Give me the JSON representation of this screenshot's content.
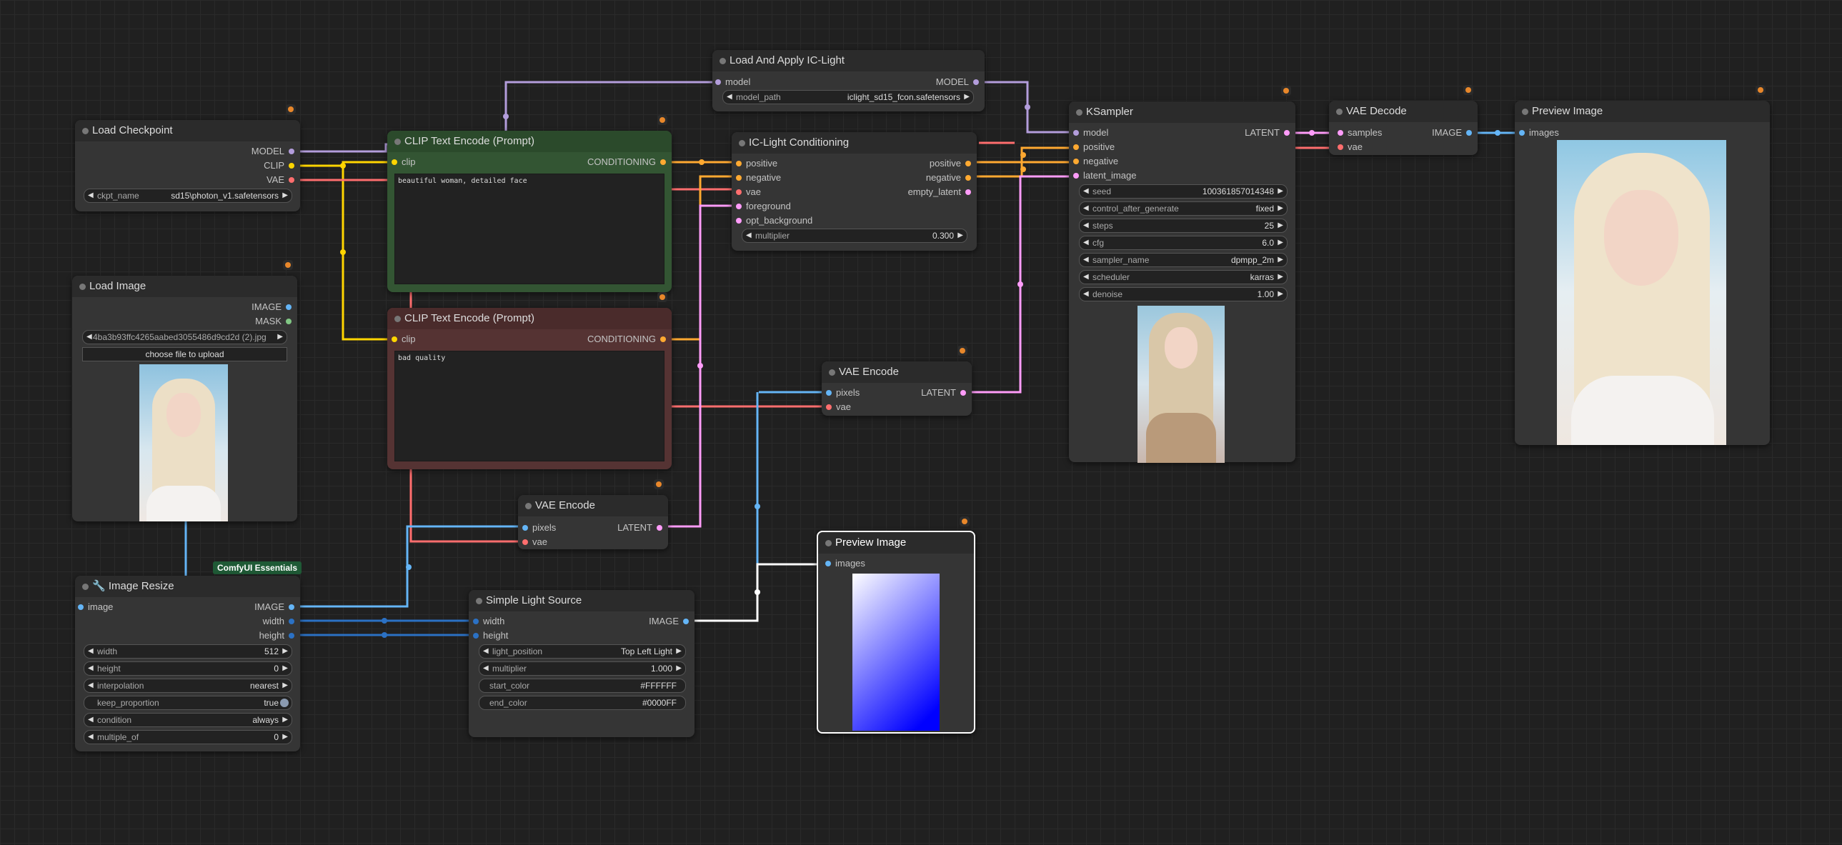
{
  "badge": "ComfyUI Essentials",
  "nodes": {
    "load_checkpoint": {
      "title": "Load Checkpoint",
      "out": [
        "MODEL",
        "CLIP",
        "VAE"
      ],
      "w_name": "ckpt_name",
      "w_val": "sd15\\photon_v1.safetensors"
    },
    "load_image": {
      "title": "Load Image",
      "out": [
        "IMAGE",
        "MASK"
      ],
      "w_val": "4ba3b93ffc4265aabed3055486d9cd2d (2).jpg",
      "button": "choose file to upload"
    },
    "image_resize": {
      "title": "Image Resize",
      "in": [
        "image"
      ],
      "out": [
        "IMAGE",
        "width",
        "height"
      ],
      "widgets": [
        {
          "n": "width",
          "v": "512"
        },
        {
          "n": "height",
          "v": "0"
        },
        {
          "n": "interpolation",
          "v": "nearest"
        },
        {
          "n": "keep_proportion",
          "v": "true"
        },
        {
          "n": "condition",
          "v": "always"
        },
        {
          "n": "multiple_of",
          "v": "0"
        }
      ]
    },
    "clip_pos": {
      "title": "CLIP Text Encode (Prompt)",
      "in": [
        "clip"
      ],
      "out": [
        "CONDITIONING"
      ],
      "text": "beautiful woman, detailed face"
    },
    "clip_neg": {
      "title": "CLIP Text Encode (Prompt)",
      "in": [
        "clip"
      ],
      "out": [
        "CONDITIONING"
      ],
      "text": "bad quality"
    },
    "iclight_load": {
      "title": "Load And Apply IC-Light",
      "in": [
        "model"
      ],
      "out": [
        "MODEL"
      ],
      "w_name": "model_path",
      "w_val": "iclight_sd15_fcon.safetensors"
    },
    "iclight_cond": {
      "title": "IC-Light Conditioning",
      "in": [
        "positive",
        "negative",
        "vae",
        "foreground",
        "opt_background"
      ],
      "out": [
        "positive",
        "negative",
        "empty_latent"
      ],
      "w_name": "multiplier",
      "w_val": "0.300"
    },
    "vae_encode_1": {
      "title": "VAE Encode",
      "in": [
        "pixels",
        "vae"
      ],
      "out": [
        "LATENT"
      ]
    },
    "vae_encode_2": {
      "title": "VAE Encode",
      "in": [
        "pixels",
        "vae"
      ],
      "out": [
        "LATENT"
      ]
    },
    "simple_light": {
      "title": "Simple Light Source",
      "in": [
        "width",
        "height"
      ],
      "out": [
        "IMAGE"
      ],
      "widgets": [
        {
          "n": "light_position",
          "v": "Top Left Light"
        },
        {
          "n": "multiplier",
          "v": "1.000"
        },
        {
          "n": "start_color",
          "v": "#FFFFFF"
        },
        {
          "n": "end_color",
          "v": "#0000FF"
        }
      ]
    },
    "preview_small": {
      "title": "Preview Image",
      "in": [
        "images"
      ]
    },
    "ksampler": {
      "title": "KSampler",
      "in": [
        "model",
        "positive",
        "negative",
        "latent_image"
      ],
      "out": [
        "LATENT"
      ],
      "widgets": [
        {
          "n": "seed",
          "v": "100361857014348"
        },
        {
          "n": "control_after_generate",
          "v": "fixed"
        },
        {
          "n": "steps",
          "v": "25"
        },
        {
          "n": "cfg",
          "v": "6.0"
        },
        {
          "n": "sampler_name",
          "v": "dpmpp_2m"
        },
        {
          "n": "scheduler",
          "v": "karras"
        },
        {
          "n": "denoise",
          "v": "1.00"
        }
      ]
    },
    "vae_decode": {
      "title": "VAE Decode",
      "in": [
        "samples",
        "vae"
      ],
      "out": [
        "IMAGE"
      ]
    },
    "preview_big": {
      "title": "Preview Image",
      "in": [
        "images"
      ]
    }
  },
  "colors": {
    "model": "#b39ddb",
    "clip": "#ffd500",
    "vae": "#ff6e6e",
    "conditioning": "#ffa931",
    "latent": "#ff9cf9",
    "image": "#64b5f6",
    "int": "#2b71c4",
    "light": "#ffffff"
  }
}
